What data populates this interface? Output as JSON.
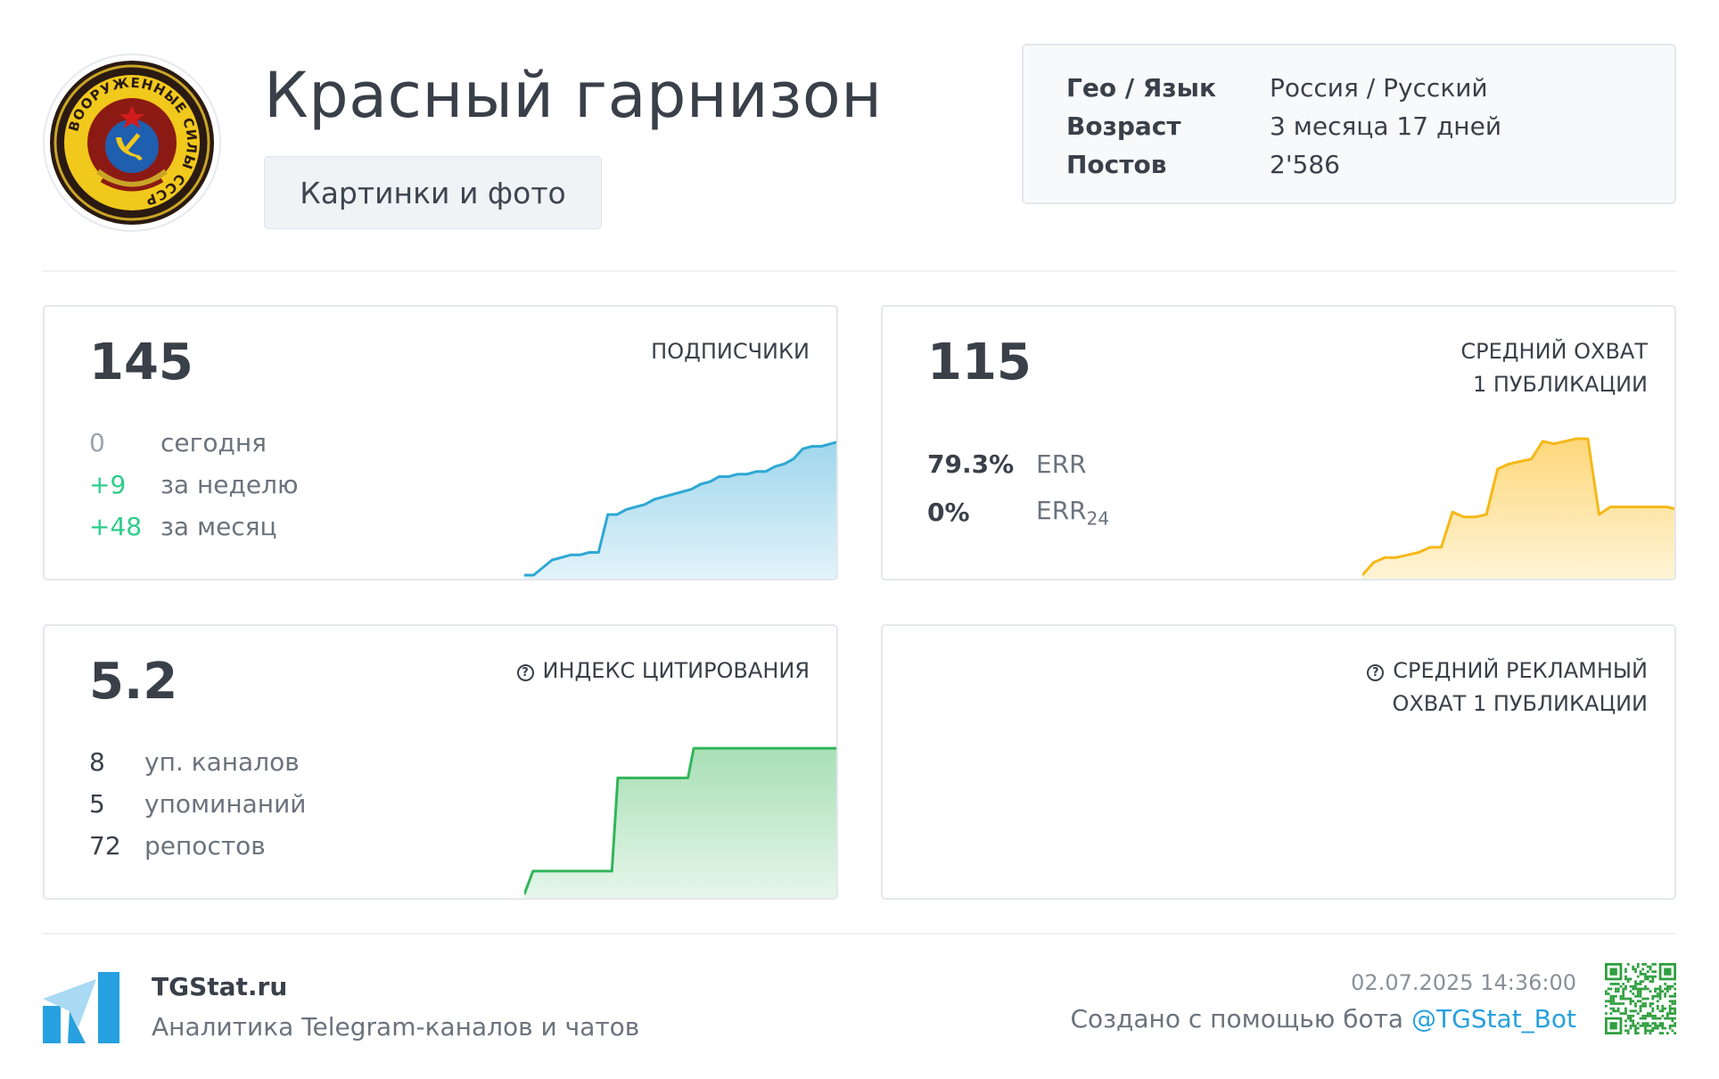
{
  "channel": {
    "title": "Красный гарнизон",
    "category": "Картинки и фото",
    "avatar_text": "ВООРУЖЕННЫЕ СИЛЫ СССР"
  },
  "info": {
    "rows": [
      {
        "key": "Гео / Язык",
        "value": "Россия / Русский"
      },
      {
        "key": "Возраст",
        "value": "3 месяца 17 дней"
      },
      {
        "key": "Постов",
        "value": "2'586"
      }
    ]
  },
  "subscribers": {
    "value": "145",
    "label": "ПОДПИСЧИКИ",
    "rows": [
      {
        "num": "0",
        "text": "сегодня",
        "color": "#9aa3ad"
      },
      {
        "num": "+9",
        "text": "за неделю",
        "color": "#2ecc8a"
      },
      {
        "num": "+48",
        "text": "за месяц",
        "color": "#2ecc8a"
      }
    ],
    "chart": {
      "color": "#2ea8d4",
      "fill_top": "#9fd6ec",
      "fill_bottom": "#e2f3fa",
      "points": [
        0,
        0,
        3,
        6,
        7,
        8,
        8,
        9,
        9,
        24,
        24,
        26,
        27,
        28,
        30,
        31,
        32,
        33,
        34,
        36,
        37,
        39,
        39,
        40,
        40,
        41,
        41,
        43,
        44,
        46,
        50,
        51,
        51,
        52,
        53
      ]
    }
  },
  "reach": {
    "value": "115",
    "label_line1": "СРЕДНИЙ ОХВАТ",
    "label_line2": "1 ПУБЛИКАЦИИ",
    "rows": [
      {
        "num": "79.3%",
        "text": "ERR",
        "sub": ""
      },
      {
        "num": "0%",
        "text": "ERR",
        "sub": "24"
      }
    ],
    "chart": {
      "color": "#f5b818",
      "fill_top": "#fdd77a",
      "fill_bottom": "#fff4d6",
      "points": [
        0,
        5,
        7,
        7,
        8,
        9,
        11,
        11,
        25,
        23,
        23,
        24,
        42,
        44,
        45,
        46,
        53,
        52,
        53,
        54,
        54,
        24,
        27,
        27,
        27,
        27,
        27,
        27,
        26
      ]
    }
  },
  "citation": {
    "value": "5.2",
    "label": "ИНДЕКС ЦИТИРОВАНИЯ",
    "rows": [
      {
        "num": "8",
        "text": "уп. каналов"
      },
      {
        "num": "5",
        "text": "упоминаний"
      },
      {
        "num": "72",
        "text": "репостов"
      }
    ],
    "chart": {
      "color": "#32b55a",
      "fill_top": "#a8dfb5",
      "fill_bottom": "#e6f6ea",
      "points": [
        [
          0,
          0
        ],
        [
          1.5,
          11
        ],
        [
          15,
          11
        ],
        [
          16,
          55
        ],
        [
          28,
          55
        ],
        [
          29,
          69
        ],
        [
          54,
          69
        ]
      ]
    }
  },
  "ad_reach": {
    "label_line1": "СРЕДНИЙ РЕКЛАМНЫЙ",
    "label_line2": "ОХВАТ 1 ПУБЛИКАЦИИ"
  },
  "footer": {
    "site": "TGStat.ru",
    "description": "Аналитика Telegram-каналов и чатов",
    "datetime": "02.07.2025 14:36:00",
    "made_with": "Создано с помощью бота ",
    "bot": "@TGStat_Bot",
    "brand_color": "#27a0e0"
  }
}
